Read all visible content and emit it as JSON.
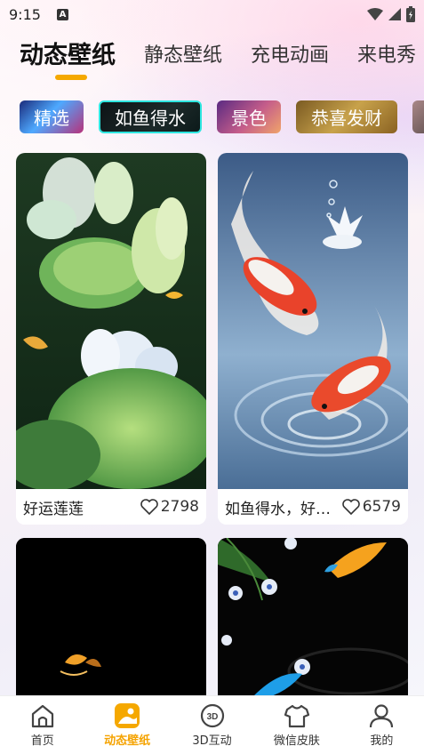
{
  "status_bar": {
    "time": "9:15",
    "notification_icon": "A"
  },
  "top_tabs": [
    {
      "label": "动态壁纸",
      "active": true
    },
    {
      "label": "静态壁纸",
      "active": false
    },
    {
      "label": "充电动画",
      "active": false
    },
    {
      "label": "来电秀",
      "active": false
    }
  ],
  "categories": [
    {
      "label": "精选"
    },
    {
      "label": "如鱼得水",
      "selected": true
    },
    {
      "label": "景色"
    },
    {
      "label": "恭喜发财"
    }
  ],
  "cards": [
    {
      "title": "好运莲莲",
      "likes": "2798"
    },
    {
      "title": "如鱼得水，好运连连",
      "likes": "6579"
    },
    {
      "title": "",
      "likes": ""
    },
    {
      "title": "",
      "likes": ""
    }
  ],
  "bottom_nav": [
    {
      "label": "首页",
      "icon": "home-icon"
    },
    {
      "label": "动态壁纸",
      "icon": "wallpaper-icon",
      "active": true
    },
    {
      "label": "3D互动",
      "icon": "3d-icon"
    },
    {
      "label": "微信皮肤",
      "icon": "shirt-icon"
    },
    {
      "label": "我的",
      "icon": "person-icon"
    }
  ],
  "colors": {
    "accent": "#f5a800",
    "chip_border": "#2ee6e0"
  }
}
